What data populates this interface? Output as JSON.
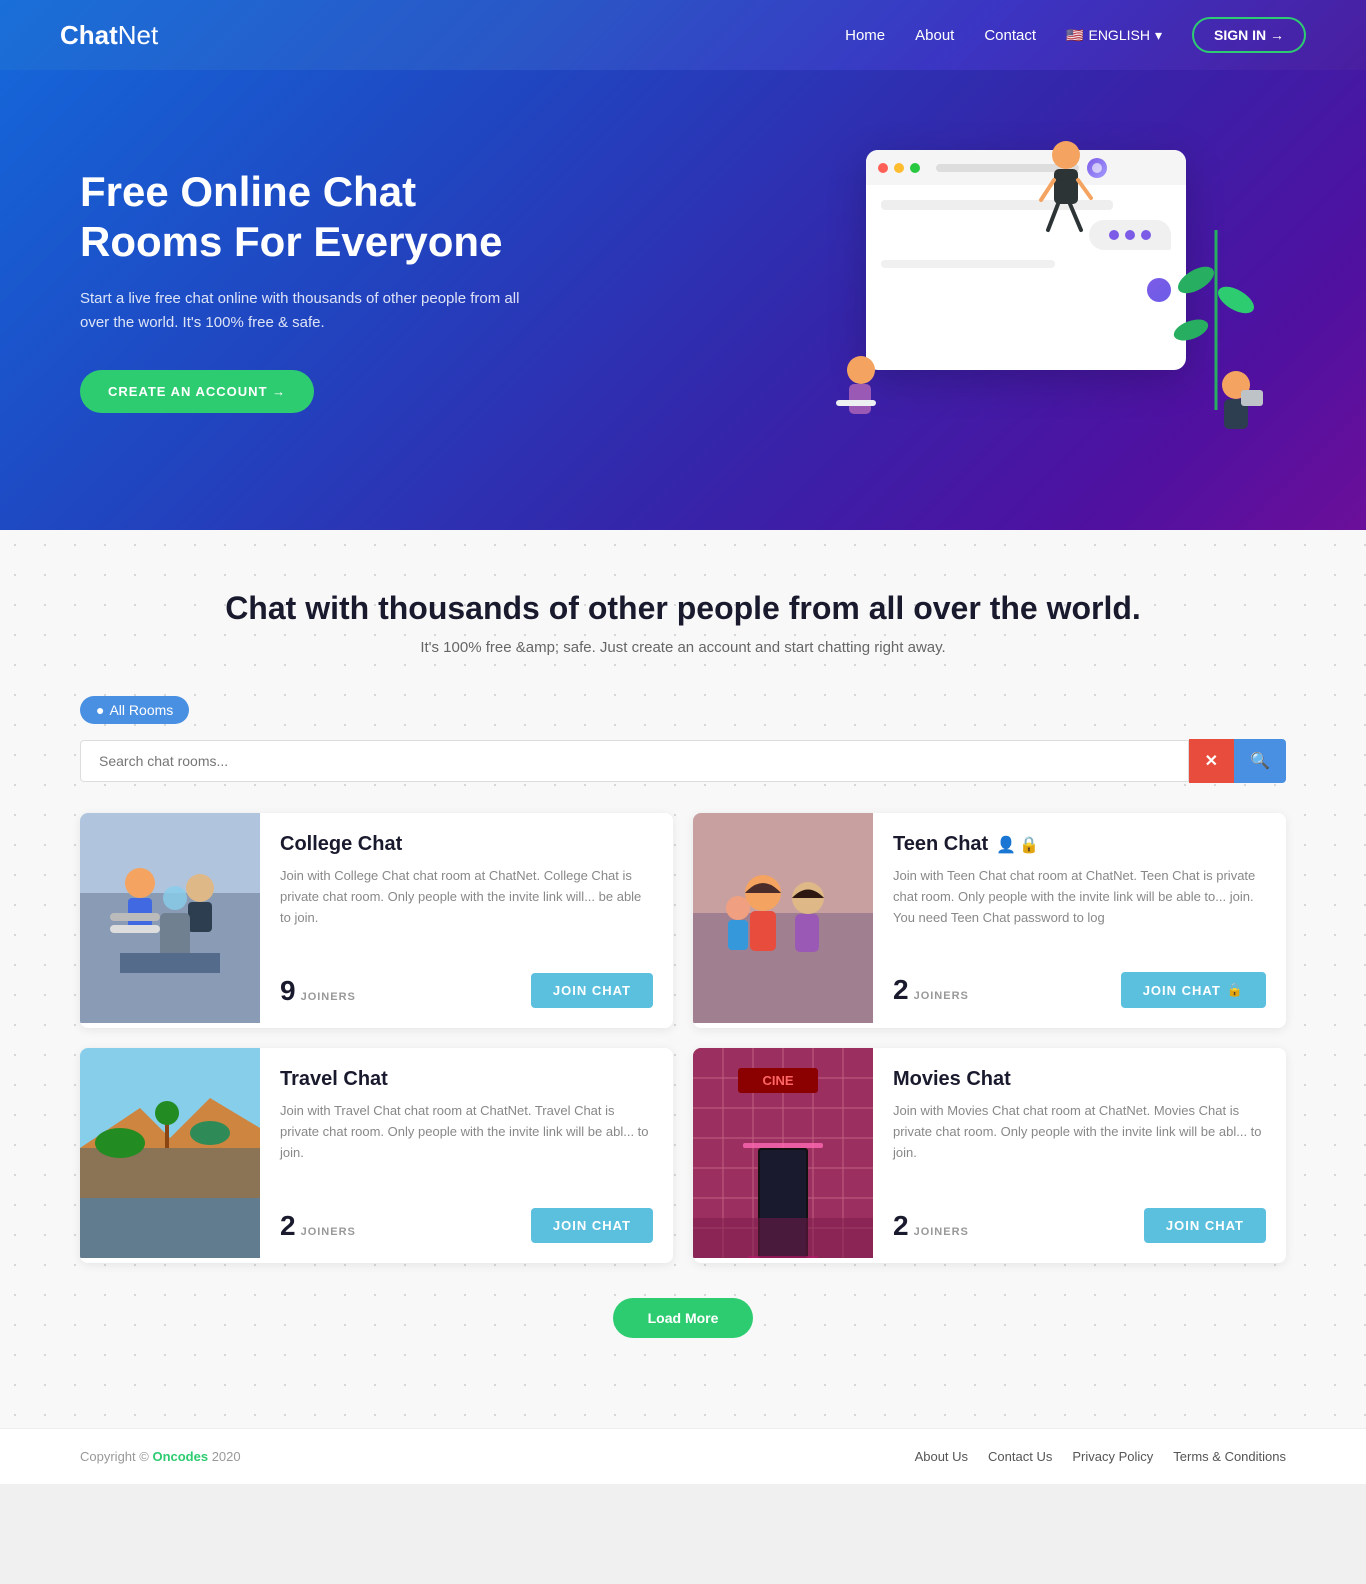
{
  "brand": {
    "chat": "Chat",
    "net": "Net"
  },
  "navbar": {
    "links": [
      {
        "label": "Home",
        "name": "home"
      },
      {
        "label": "About",
        "name": "about"
      },
      {
        "label": "Contact",
        "name": "contact"
      }
    ],
    "language": "ENGLISH",
    "signin_label": "SIGN IN →"
  },
  "hero": {
    "title": "Free Online Chat Rooms For Everyone",
    "subtitle": "Start a live free chat online with thousands of other people from all over the world. It's 100% free & safe.",
    "cta_label": "CREATE AN ACCOUNT →"
  },
  "main": {
    "section_title": "Chat with thousands of other people from all over the world.",
    "section_subtitle": "It's 100% free &amp; safe. Just create an account and start chatting right away.",
    "tab_all_rooms": "All Rooms",
    "search_placeholder": "Search chat rooms...",
    "load_more_label": "Load More",
    "rooms": [
      {
        "id": "college",
        "title": "College Chat",
        "description": "Join with College Chat chat room at ChatNet. College Chat is private chat room. Only people with the invite link will... be able to join.",
        "joiners": "9",
        "join_label": "JOIN CHAT",
        "private": false
      },
      {
        "id": "teen",
        "title": "Teen Chat",
        "description": "Join with Teen Chat chat room at ChatNet. Teen Chat is private chat room. Only people with the invite link will be able to... join. You need Teen Chat password to log",
        "joiners": "2",
        "join_label": "JOIN CHAT",
        "private": true,
        "lock_icon": "🔒"
      },
      {
        "id": "travel",
        "title": "Travel Chat",
        "description": "Join with Travel Chat chat room at ChatNet. Travel Chat is private chat room. Only people with the invite link will be abl... to join.",
        "joiners": "2",
        "join_label": "JOIN CHAT",
        "private": false
      },
      {
        "id": "movies",
        "title": "Movies Chat",
        "description": "Join with Movies Chat chat room at ChatNet. Movies Chat is private chat room. Only people with the invite link will be abl... to join.",
        "joiners": "2",
        "join_label": "JOIN CHAT",
        "private": false
      }
    ]
  },
  "footer": {
    "copyright": "Copyright © Oncodes 2020",
    "brand_link": "Oncodes",
    "links": [
      {
        "label": "About Us"
      },
      {
        "label": "Contact Us"
      },
      {
        "label": "Privacy Policy"
      },
      {
        "label": "Terms & Conditions"
      }
    ]
  }
}
